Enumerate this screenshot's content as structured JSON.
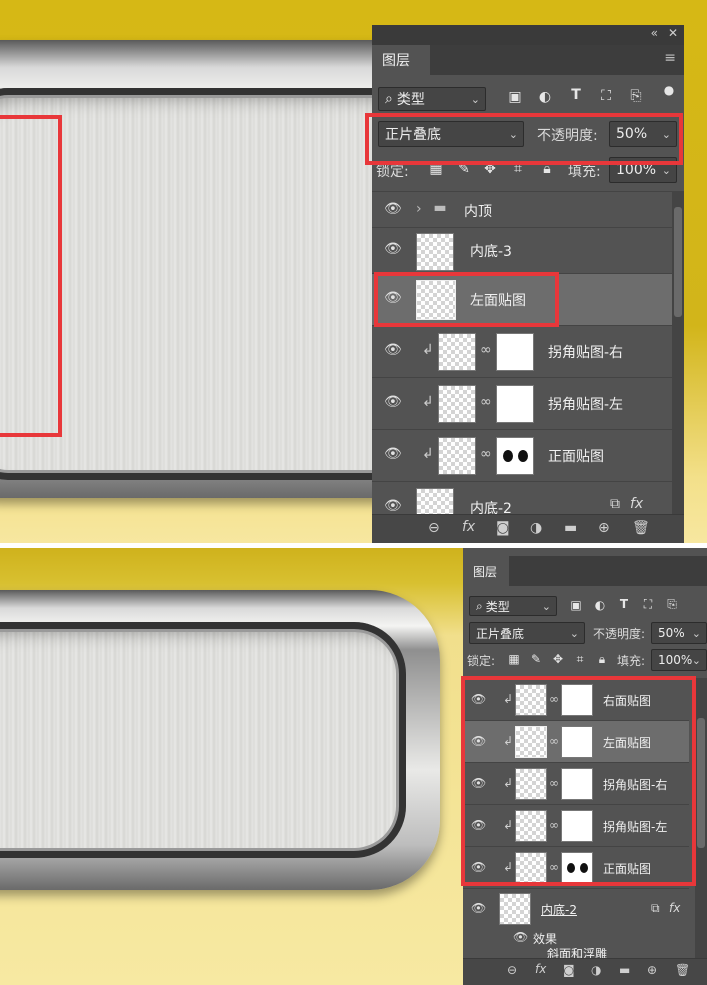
{
  "top": {
    "panel": {
      "collapse_glyph": "«",
      "close_glyph": "✕",
      "tab": "图层",
      "menu_icon": "menu-icon",
      "filter": {
        "search_glyph": "⌕",
        "value": "类型"
      },
      "blend_mode": "正片叠底",
      "opacity_label": "不透明度:",
      "opacity_value": "50%",
      "lock_label": "锁定:",
      "fill_label": "填充:",
      "fill_value": "100%",
      "layers": [
        {
          "name": "内顶",
          "kind": "group"
        },
        {
          "name": "内底-3",
          "kind": "layer"
        },
        {
          "name": "左面贴图",
          "kind": "layer",
          "active": true
        },
        {
          "name": "拐角贴图-右",
          "kind": "clipped"
        },
        {
          "name": "拐角贴图-左",
          "kind": "clipped"
        },
        {
          "name": "正面贴图",
          "kind": "clipped"
        },
        {
          "name": "内底-2",
          "kind": "layer"
        }
      ],
      "fx_label": "fx"
    }
  },
  "bottom": {
    "panel": {
      "tab": "图层",
      "filter": {
        "search_glyph": "⌕",
        "value": "类型"
      },
      "blend_mode": "正片叠底",
      "opacity_label": "不透明度:",
      "opacity_value": "50%",
      "lock_label": "锁定:",
      "fill_label": "填充:",
      "fill_value": "100%",
      "layers": [
        {
          "name": "右面贴图"
        },
        {
          "name": "左面贴图",
          "active": true
        },
        {
          "name": "拐角贴图-右"
        },
        {
          "name": "拐角贴图-左"
        },
        {
          "name": "正面贴图"
        }
      ],
      "base_layer": "内底-2",
      "effects_label": "效果",
      "effects_sub": "斜面和浮雕",
      "fx_label": "fx"
    }
  },
  "colors": {
    "highlight_red": "#e8373a",
    "panel_bg": "#535353",
    "canvas_yellow": "#d6b815"
  }
}
